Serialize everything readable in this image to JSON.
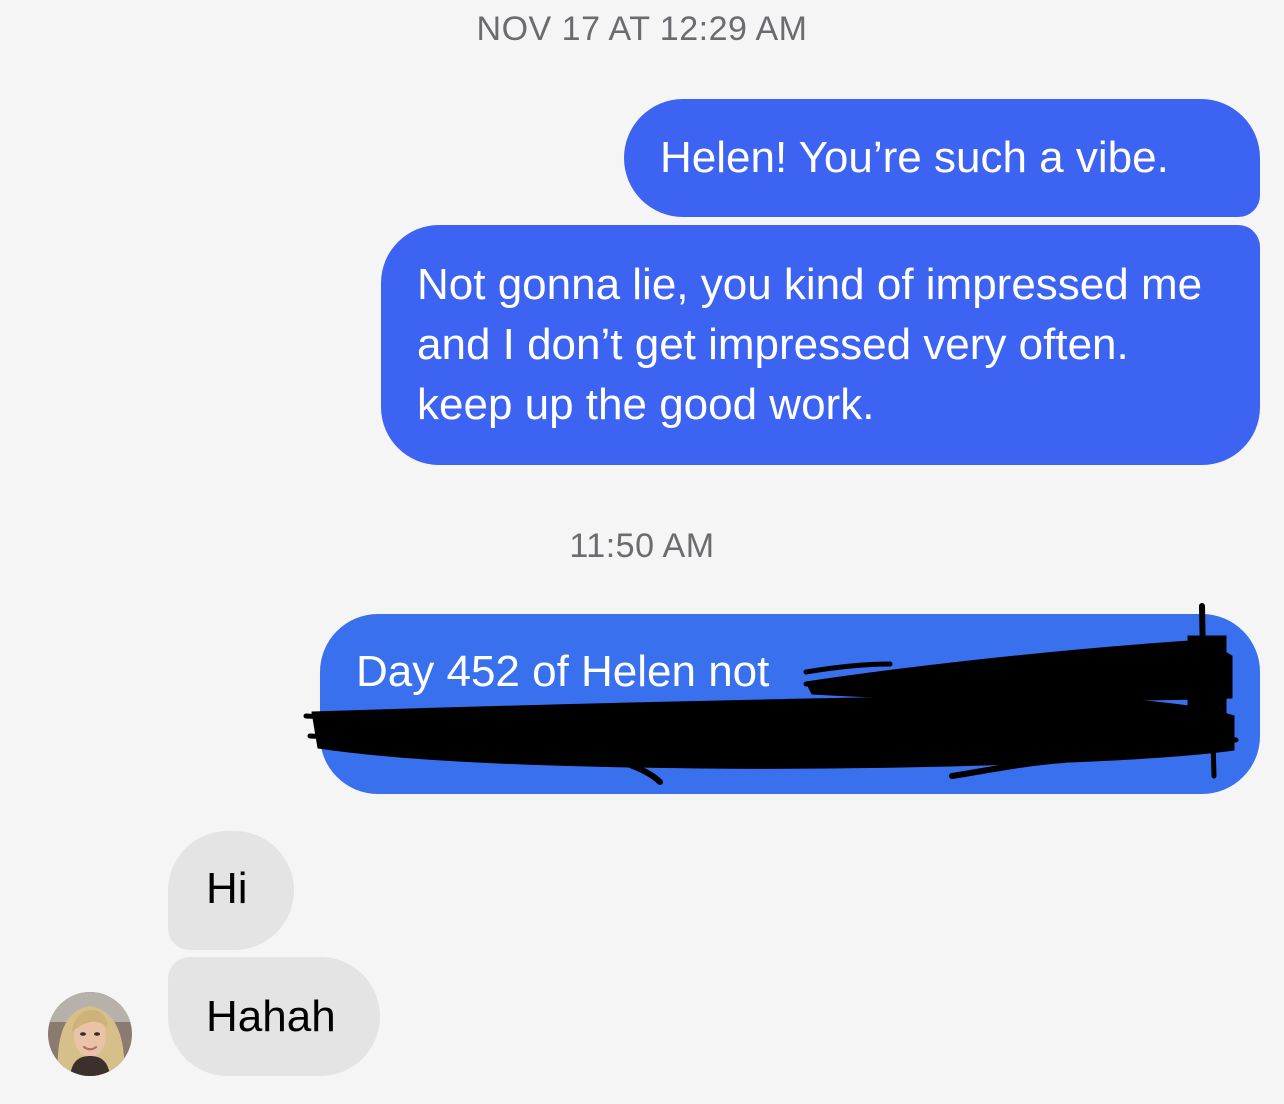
{
  "conversation": {
    "timestamps": [
      "NOV 17 AT 12:29 AM",
      "11:50 AM"
    ],
    "messages": [
      {
        "sender": "self",
        "text": "Helen! You’re such a vibe."
      },
      {
        "sender": "self",
        "text": "Not gonna lie, you kind of impressed me and I don’t get impressed very often. keep up the good work."
      },
      {
        "sender": "self",
        "text": "Day 452 of Helen not",
        "redacted": true
      },
      {
        "sender": "contact",
        "text": "Hi"
      },
      {
        "sender": "contact",
        "text": "Hahah"
      }
    ]
  },
  "colors": {
    "background": "#f5f5f5",
    "outgoing_bubble": "#3d63f3",
    "incoming_bubble": "#e4e4e4",
    "timestamp_text": "#6b6b70",
    "redaction": "#000000"
  },
  "icons": {
    "contact_avatar": "contact-avatar-photo"
  }
}
